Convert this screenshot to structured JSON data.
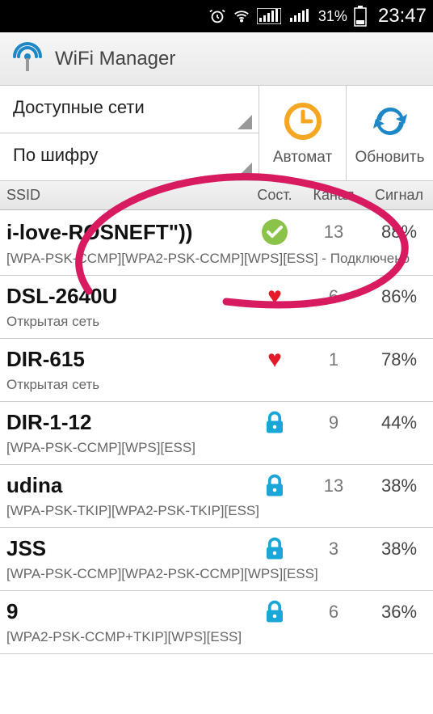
{
  "statusbar": {
    "battery_pct": "31%",
    "time": "23:47"
  },
  "app": {
    "title": "WiFi Manager"
  },
  "dropdowns": {
    "networks": "Доступные сети",
    "filter": "По шифру"
  },
  "actions": {
    "auto": "Автомат",
    "refresh": "Обновить"
  },
  "columns": {
    "ssid": "SSID",
    "state": "Сост.",
    "channel": "Канал",
    "signal": "Сигнал"
  },
  "networks": [
    {
      "ssid": "i-love-ROSNEFT\"))",
      "channel": "13",
      "signal": "88%",
      "sub": "[WPA-PSK-CCMP][WPA2-PSK-CCMP][WPS][ESS] - Подключено",
      "status": "connected"
    },
    {
      "ssid": "DSL-2640U",
      "channel": "6",
      "signal": "86%",
      "sub": "Открытая сеть",
      "status": "favorite"
    },
    {
      "ssid": "DIR-615",
      "channel": "1",
      "signal": "78%",
      "sub": "Открытая сеть",
      "status": "favorite"
    },
    {
      "ssid": "DIR-1-12",
      "channel": "9",
      "signal": "44%",
      "sub": "[WPA-PSK-CCMP][WPS][ESS]",
      "status": "locked"
    },
    {
      "ssid": "udina",
      "channel": "13",
      "signal": "38%",
      "sub": "[WPA-PSK-TKIP][WPA2-PSK-TKIP][ESS]",
      "status": "locked"
    },
    {
      "ssid": "JSS",
      "channel": "3",
      "signal": "38%",
      "sub": "[WPA-PSK-CCMP][WPA2-PSK-CCMP][WPS][ESS]",
      "status": "locked"
    },
    {
      "ssid": "9",
      "channel": "6",
      "signal": "36%",
      "sub": "[WPA2-PSK-CCMP+TKIP][WPS][ESS]",
      "status": "locked"
    }
  ],
  "colors": {
    "accent": "#f5a623",
    "refresh": "#1e88c7",
    "lock": "#1aa7d8",
    "heart": "#e41b2b",
    "check_bg": "#8bc34a",
    "annotation": "#d81b60"
  }
}
